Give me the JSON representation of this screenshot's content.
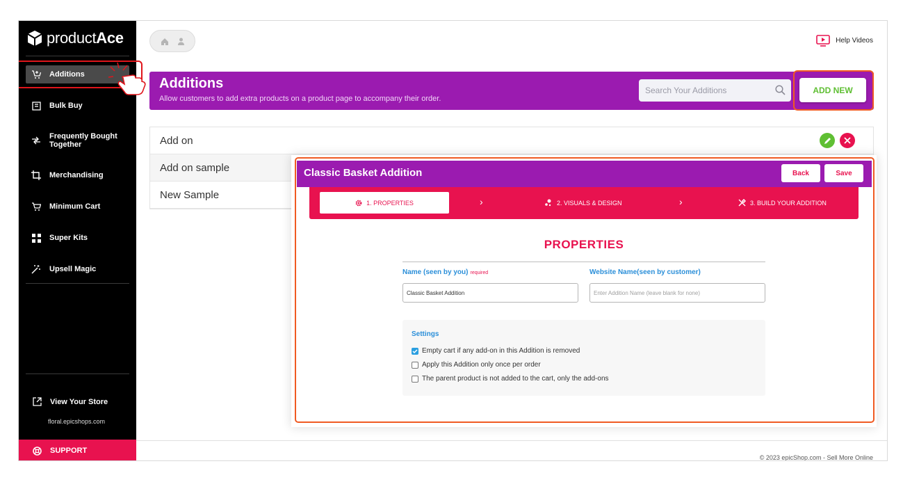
{
  "brand": {
    "name_light": "product",
    "name_bold": "Ace"
  },
  "sidebar": {
    "items": [
      {
        "label": "Additions",
        "icon": "cart-plus-icon"
      },
      {
        "label": "Bulk Buy",
        "icon": "box-icon"
      },
      {
        "label": "Frequently Bought Together",
        "icon": "arrows-icon"
      },
      {
        "label": "Merchandising",
        "icon": "crop-icon"
      },
      {
        "label": "Minimum Cart",
        "icon": "cart-icon"
      },
      {
        "label": "Super Kits",
        "icon": "kit-icon"
      },
      {
        "label": "Upsell Magic",
        "icon": "magic-wand-icon"
      }
    ],
    "view_store": "View Your Store",
    "store_url": "floral.epicshops.com",
    "support": "SUPPORT"
  },
  "topbar": {
    "help": "Help Videos"
  },
  "header": {
    "title": "Additions",
    "subtitle": "Allow customers to add extra products on a product page to accompany their order.",
    "search_placeholder": "Search Your Additions",
    "add_new": "ADD NEW"
  },
  "list": {
    "rows": [
      "Add on",
      "Add on sample",
      "New Sample"
    ]
  },
  "modal": {
    "title": "Classic Basket Addition",
    "back": "Back",
    "save": "Save",
    "steps": [
      "1. PROPERTIES",
      "2. VISUALS & DESIGN",
      "3. BUILD YOUR ADDITION"
    ],
    "section_title": "PROPERTIES",
    "name_label": "Name (seen by you)",
    "name_required": "required",
    "name_value": "Classic Basket Addition",
    "website_label": "Website Name(seen by customer)",
    "website_placeholder": "Enter Addition Name (leave blank for none)",
    "settings_title": "Settings",
    "settings": [
      {
        "label": "Empty cart if any add-on in this Addition is removed",
        "checked": true
      },
      {
        "label": "Apply this Addition only once per order",
        "checked": false
      },
      {
        "label": "The parent product is not added to the cart, only the add-ons",
        "checked": false
      }
    ]
  },
  "footer": "© 2023 epicShop.com - Sell More Online",
  "colors": {
    "purple": "#9b1bb0",
    "pink": "#e8124f",
    "green": "#5fbf33",
    "orange_outline": "#f05a22",
    "blue": "#2b8fd9"
  }
}
